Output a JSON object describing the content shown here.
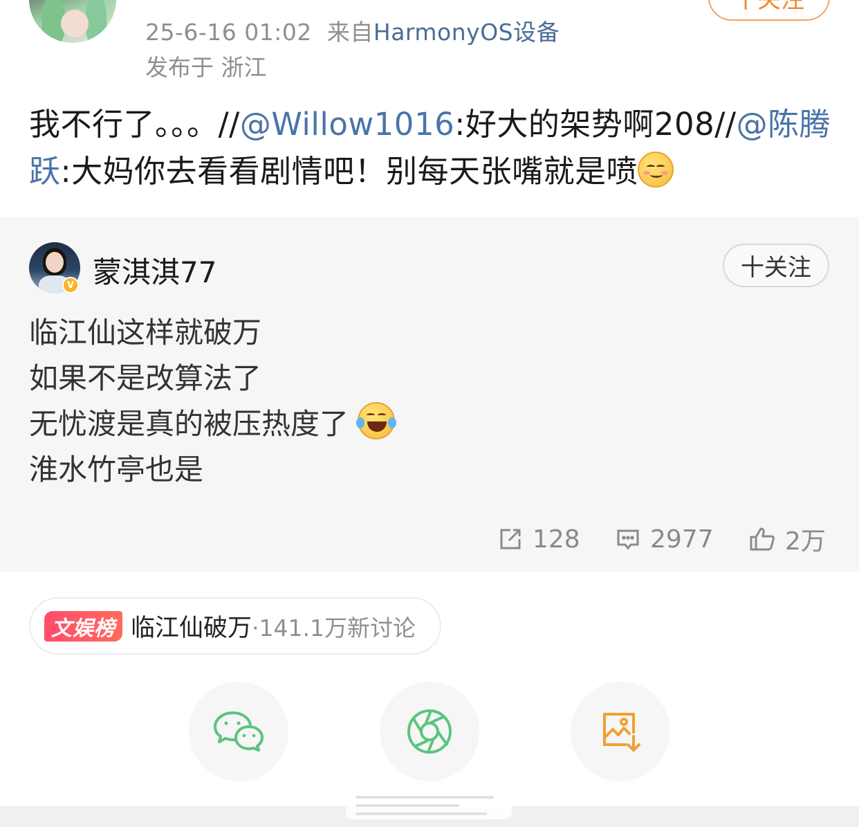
{
  "repost": {
    "follow_label": "十关注",
    "time": "25-6-16 01:02",
    "source_prefix": "来自",
    "device": "HarmonyOS设备",
    "location": "发布于 浙江",
    "text_part1": "我不行了。。。//",
    "mention1": "@Willow1016",
    "text_part2": ":好大的架势啊208//",
    "mention2": "@陈腾跃",
    "text_part3": ":大妈你去看看剧情吧！别每天张嘴就是喷",
    "emoji": "smile-emoji"
  },
  "original": {
    "author": "蒙淇淇77",
    "verified_badge": "V",
    "follow_label": "十关注",
    "lines": [
      "临江仙这样就破万",
      "如果不是改算法了",
      "无忧渡是真的被压热度了",
      "淮水竹亭也是"
    ],
    "line3_emoji": "laugh-cry-emoji",
    "reposts": "128",
    "comments": "2977",
    "likes": "2万"
  },
  "topic": {
    "badge": "文娱榜",
    "name": "临江仙破万",
    "stat": "·141.1万新讨论"
  },
  "share": {
    "wechat_icon": "wechat-icon",
    "moments_icon": "wechat-moments-icon",
    "save_image_icon": "save-image-icon"
  },
  "colors": {
    "link": "#4a73a8",
    "follow_orange": "#f08a2a",
    "topic_red": "#ff4d6d",
    "wechat_green": "#5bc47f",
    "save_orange": "#f0a030"
  }
}
